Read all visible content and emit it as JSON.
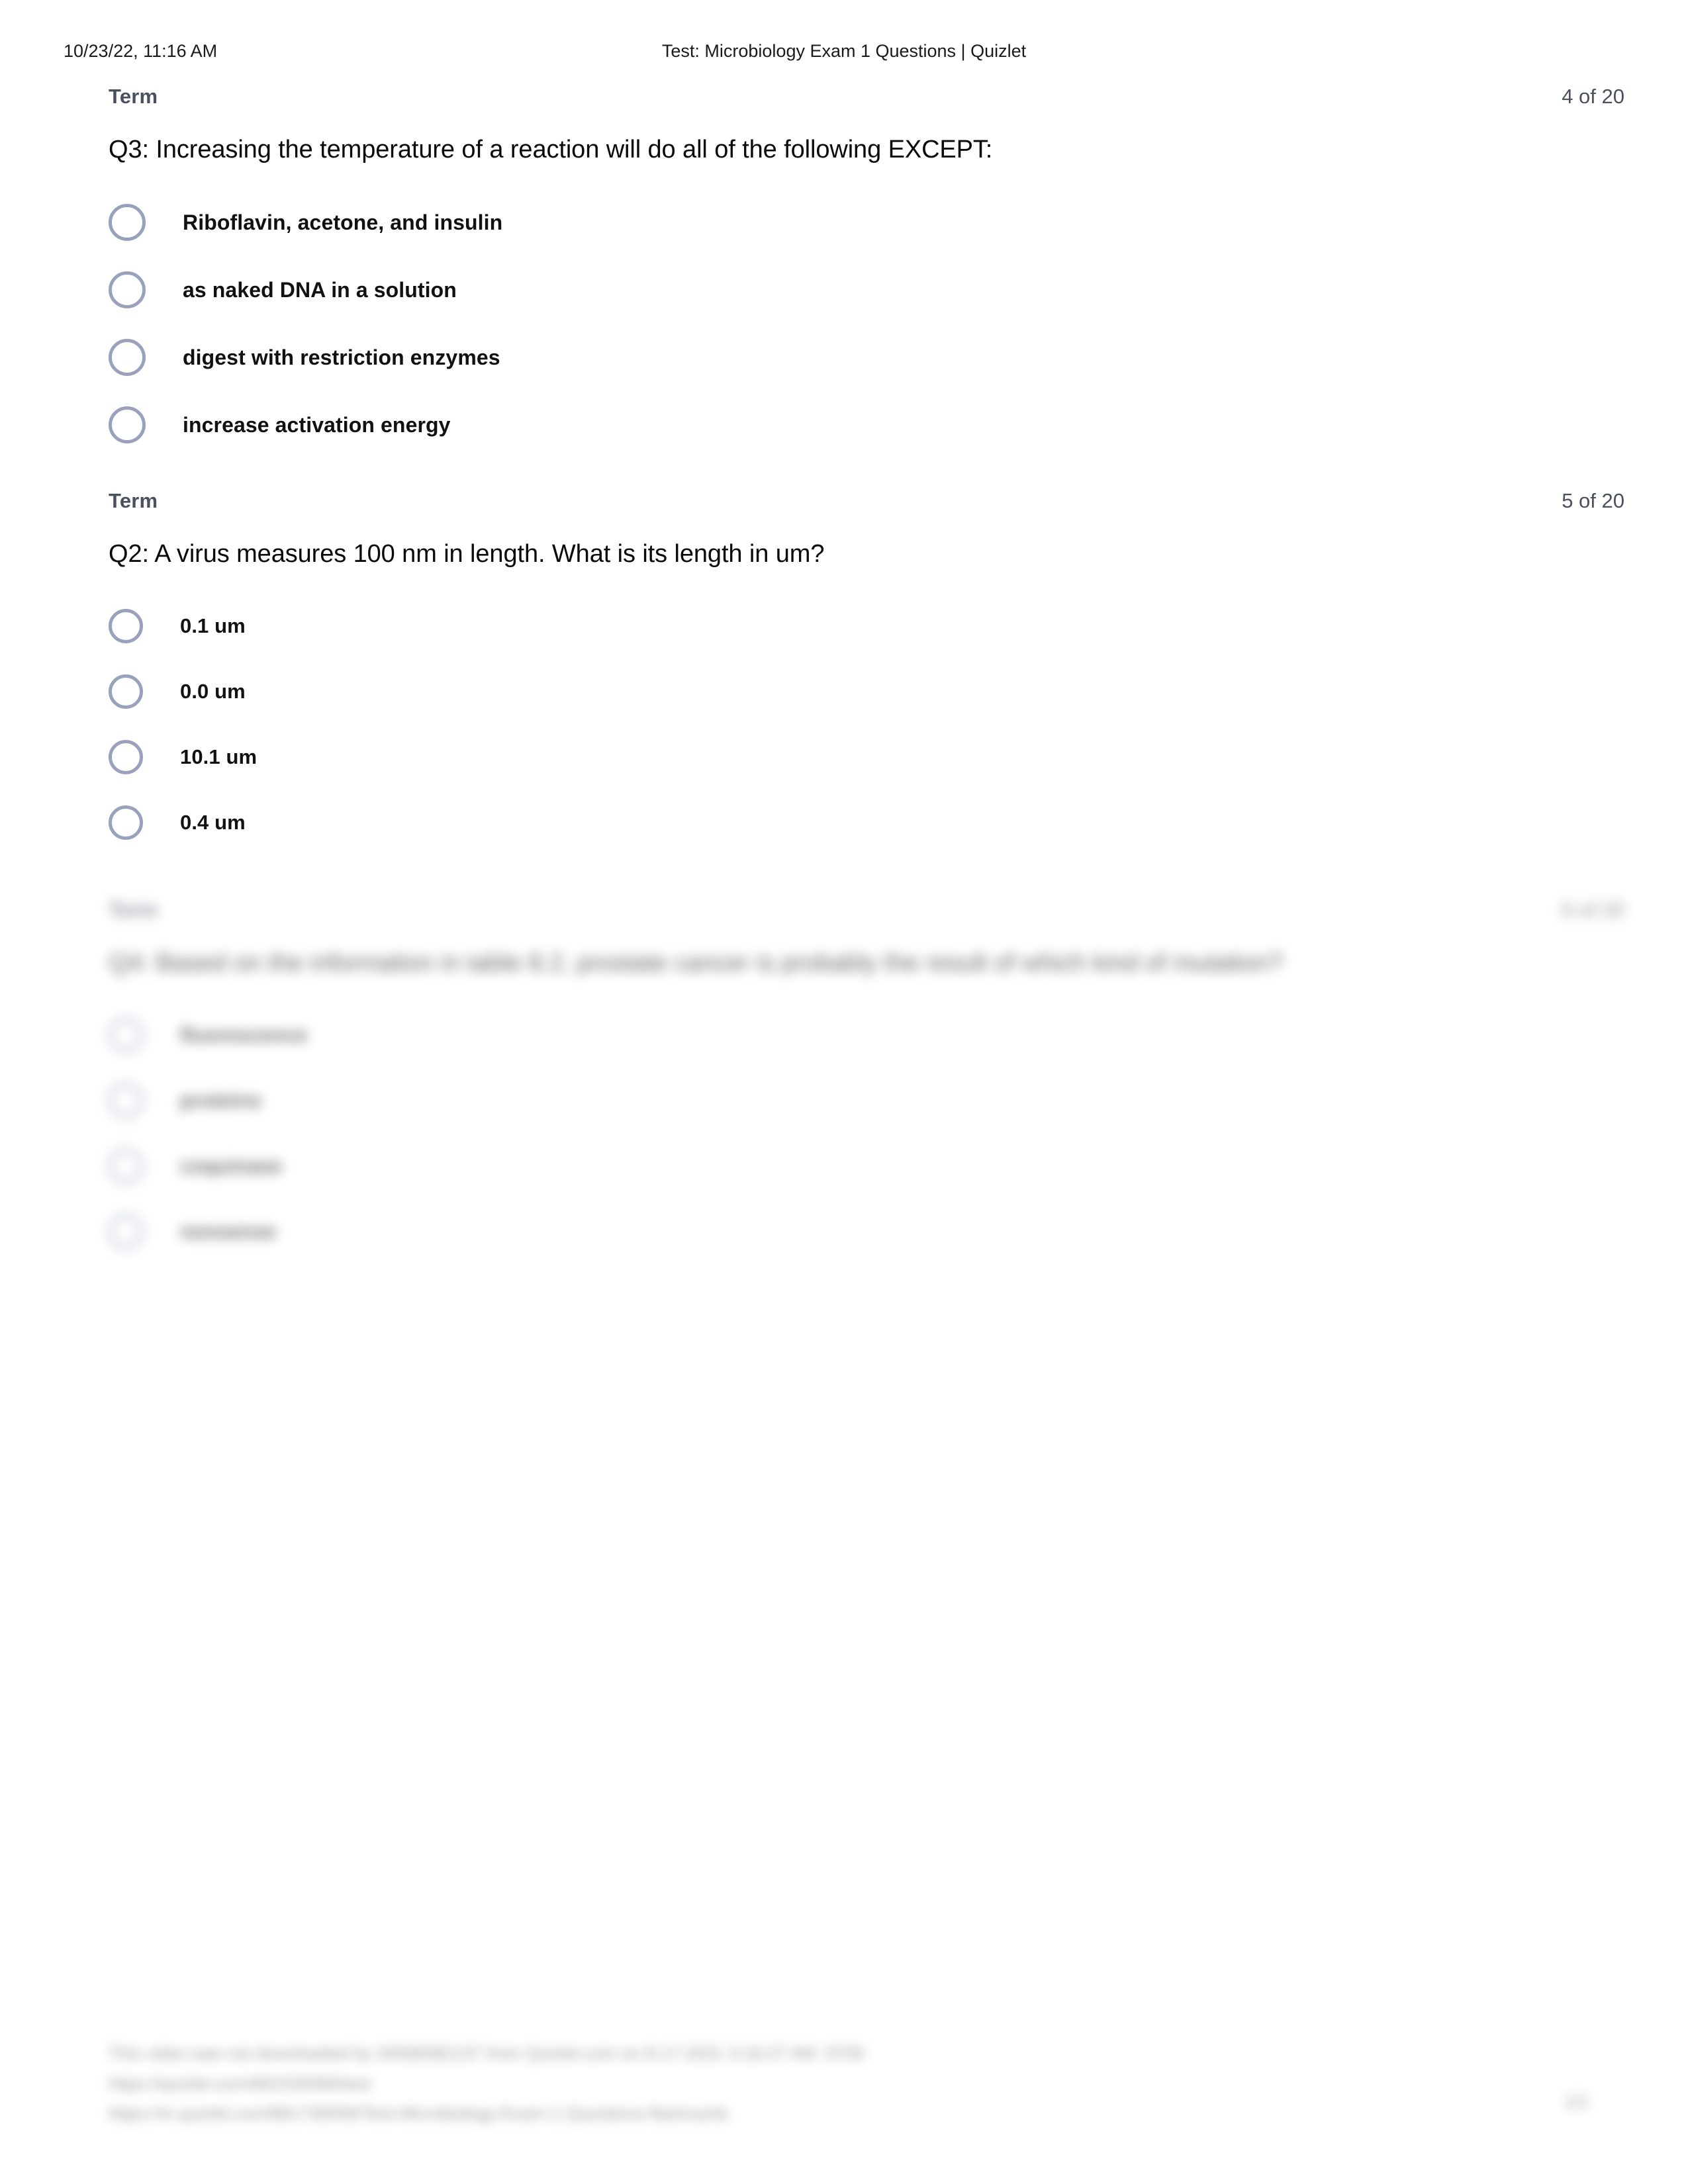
{
  "print_header": {
    "date": "10/23/22, 11:16 AM",
    "title": "Test: Microbiology Exam 1 Questions | Quizlet"
  },
  "colors": {
    "radio_border": "#9aa1bb",
    "meta_text": "#4a5060",
    "body_text": "#0a0a0a",
    "page_background": "#ffffff"
  },
  "questions": [
    {
      "term_label": "Term",
      "counter": "4 of 20",
      "prompt": "Q3: Increasing the temperature of a reaction will do all of the following EXCEPT:",
      "options": [
        {
          "label": "Riboflavin, acetone, and insulin",
          "selected": false
        },
        {
          "label": "as naked DNA in a solution",
          "selected": false
        },
        {
          "label": "digest with restriction enzymes",
          "selected": false
        },
        {
          "label": "increase activation energy",
          "selected": false
        }
      ]
    },
    {
      "term_label": "Term",
      "counter": "5 of 20",
      "prompt": "Q2: A virus measures 100 nm in length. What is its length in um?",
      "options": [
        {
          "label": "0.1 um",
          "selected": false
        },
        {
          "label": "0.0 um",
          "selected": false
        },
        {
          "label": "10.1 um",
          "selected": false
        },
        {
          "label": "0.4 um",
          "selected": false
        }
      ]
    },
    {
      "term_label": "Term",
      "counter": "6 of 20",
      "prompt": "Q4: Based on the information in table 8.2, prostate cancer is probably the result of which kind of mutation?",
      "options": [
        {
          "label": "fluorescence",
          "selected": false
        },
        {
          "label": "proteins",
          "selected": false
        },
        {
          "label": "coquinase",
          "selected": false
        },
        {
          "label": "nonsense",
          "selected": false
        }
      ]
    }
  ],
  "page_footer": {
    "line1": "This video was not downloaded by 34568382137 from Quizlet.com on 8-17-2021 3:16:27 AM -0700",
    "line2": "https://quizlet.com/681539366/test",
    "line3": "https://m.quizlet.com/861736556/Test-Microbiology-Exam-1-Questions-flashcards",
    "page_number": "1/1"
  }
}
